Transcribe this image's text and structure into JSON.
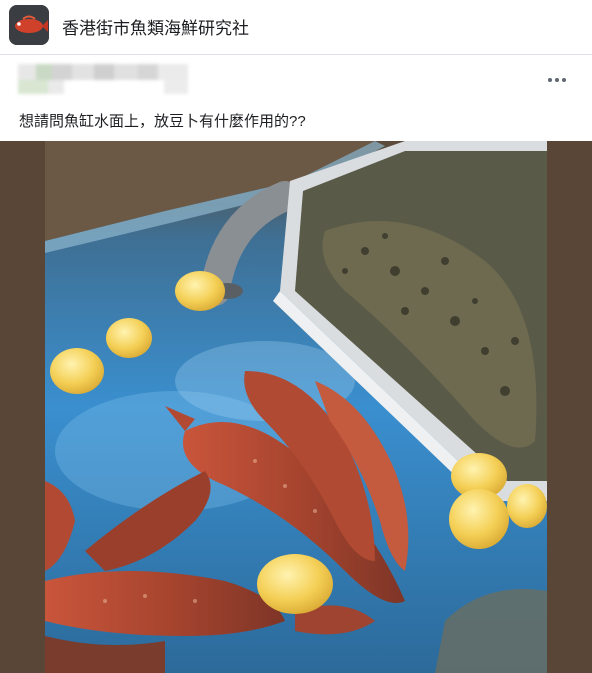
{
  "group": {
    "name": "香港街市魚類海鮮研究社",
    "avatar_icon": "red-fish-avatar-icon"
  },
  "post": {
    "more_icon": "more-options-icon",
    "text": "想請問魚缸水面上，放豆卜有什麼作用的??",
    "image_icon": "fish-tank-photo"
  },
  "colors": {
    "text": "#1c1e21",
    "divider": "#dcdfe3",
    "photo_border": "#5a4636",
    "water": "#2f7fbf",
    "fish_red": "#b8452f",
    "tofu_puff": "#f2c94c"
  }
}
